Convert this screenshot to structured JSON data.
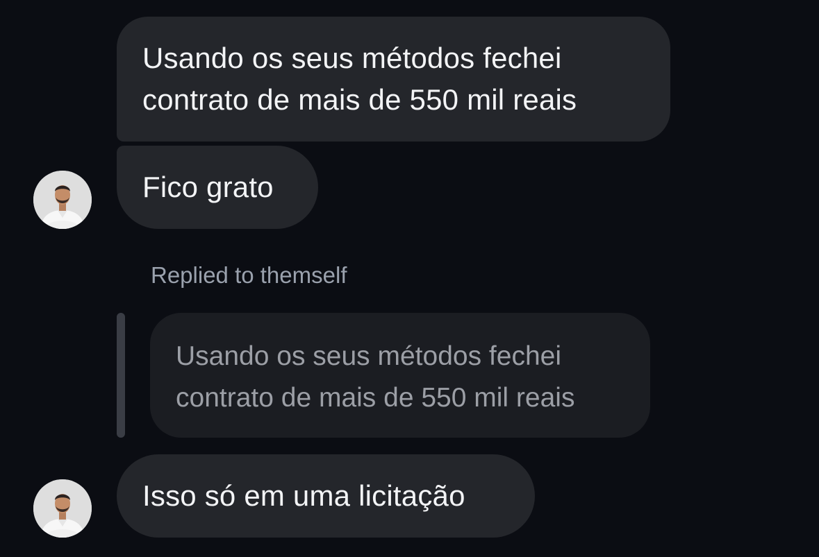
{
  "thread": {
    "message_1": {
      "lines": [
        "Usando os seus métodos fechei",
        "contrato de mais de 550 mil reais"
      ]
    },
    "message_2": {
      "text": "Fico grato"
    },
    "reply": {
      "label": "Replied to themself",
      "quoted_lines": [
        "Usando os seus métodos fechei",
        "contrato de mais de 550 mil reais"
      ]
    },
    "message_3": {
      "text": "Isso só em uma licitação"
    }
  },
  "colors": {
    "background": "#0b0d13",
    "bubble": "#24262b",
    "quoted_bubble": "#1b1d22",
    "text": "#f3f4f6",
    "muted_text": "#9aa1ad"
  }
}
